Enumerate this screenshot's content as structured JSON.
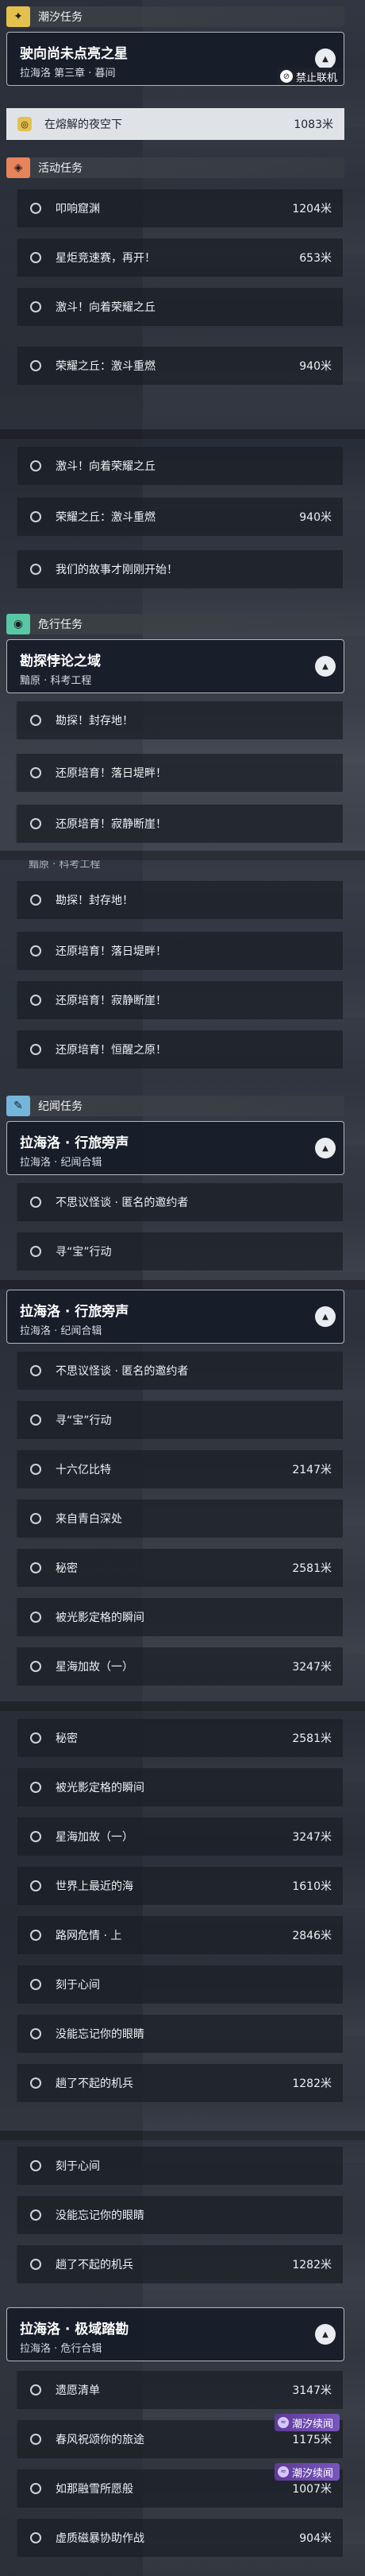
{
  "colors": {
    "tide": "#e4c04d",
    "activity": "#e9835a",
    "danger": "#58c7a4",
    "chronicle": "#74b6da",
    "badge_purple": "#6e4bb3"
  },
  "icons": {
    "tide": "sparkle-icon",
    "activity": "gift-icon",
    "danger": "eye-icon",
    "chronicle": "feather-icon",
    "collapse": "chevron-up-icon",
    "no_coop": "no-coop-icon",
    "tide_badge": "wave-icon"
  },
  "s1": {
    "cat_tide": "潮汐任务",
    "quest_title": "驶向尚未点亮之星",
    "quest_sub": "拉海洛 第三章 · 暮间",
    "no_coop": "禁止联机",
    "active_label": "在熔解的夜空下",
    "active_dist": "1083米",
    "cat_activity": "活动任务",
    "items": [
      {
        "label": "叩响窟渊",
        "dist": "1204米"
      },
      {
        "label": "星炬竞速赛，再开！",
        "dist": "653米"
      },
      {
        "label": "激斗！向着荣耀之丘",
        "dist": ""
      },
      {
        "label": "荣耀之丘：激斗重燃",
        "dist": "940米"
      }
    ]
  },
  "s2": {
    "items": [
      {
        "label": "激斗！向着荣耀之丘",
        "dist": ""
      },
      {
        "label": "荣耀之丘：激斗重燃",
        "dist": "940米"
      },
      {
        "label": "我们的故事才刚刚开始！",
        "dist": ""
      }
    ],
    "cat_danger": "危行任务",
    "quest_title": "勘探悖论之域",
    "quest_sub": "黯原 · 科考工程",
    "items2": [
      {
        "label": "勘探！封存地！",
        "dist": ""
      },
      {
        "label": "还原培育！落日堤畔！",
        "dist": ""
      },
      {
        "label": "还原培育！寂静断崖！",
        "dist": ""
      }
    ]
  },
  "s3": {
    "cut_text": "黯原 · 科考工程",
    "items": [
      {
        "label": "勘探！封存地！",
        "dist": ""
      },
      {
        "label": "还原培育！落日堤畔！",
        "dist": ""
      },
      {
        "label": "还原培育！寂静断崖！",
        "dist": ""
      },
      {
        "label": "还原培育！恒醒之原！",
        "dist": ""
      }
    ],
    "cat_chronicle": "纪闻任务",
    "quest_title": "拉海洛 · 行旅旁声",
    "quest_sub": "拉海洛 · 纪闻合辑",
    "items2": [
      {
        "label": "不思议怪谈 · 匿名的邀约者",
        "dist": ""
      },
      {
        "label": "寻“宝”行动",
        "dist": ""
      }
    ]
  },
  "s4": {
    "quest_title": "拉海洛 · 行旅旁声",
    "quest_sub": "拉海洛 · 纪闻合辑",
    "items": [
      {
        "label": "不思议怪谈 · 匿名的邀约者",
        "dist": ""
      },
      {
        "label": "寻“宝”行动",
        "dist": ""
      },
      {
        "label": "十六亿比特",
        "dist": "2147米"
      },
      {
        "label": "来自青白深处",
        "dist": ""
      },
      {
        "label": "秘密",
        "dist": "2581米"
      },
      {
        "label": "被光影定格的瞬间",
        "dist": ""
      },
      {
        "label": "星海加故（一）",
        "dist": "3247米"
      }
    ]
  },
  "s5": {
    "items": [
      {
        "label": "秘密",
        "dist": "2581米"
      },
      {
        "label": "被光影定格的瞬间",
        "dist": ""
      },
      {
        "label": "星海加故（一）",
        "dist": "3247米"
      },
      {
        "label": "世界上最近的海",
        "dist": "1610米"
      },
      {
        "label": "路网危情 · 上",
        "dist": "2846米"
      },
      {
        "label": "刻于心间",
        "dist": ""
      },
      {
        "label": "没能忘记你的眼睛",
        "dist": ""
      },
      {
        "label": "趟了不起的机兵",
        "dist": "1282米"
      }
    ]
  },
  "s6": {
    "items": [
      {
        "label": "刻于心间",
        "dist": ""
      },
      {
        "label": "没能忘记你的眼睛",
        "dist": ""
      },
      {
        "label": "趟了不起的机兵",
        "dist": "1282米"
      }
    ],
    "quest_title": "拉海洛 · 极域踏勘",
    "quest_sub": "拉海洛 · 危行合辑",
    "items2": [
      {
        "label": "遗愿清单",
        "dist": "3147米",
        "badge": ""
      },
      {
        "label": "春风祝颂你的旅途",
        "dist": "1175米",
        "badge": "潮汐续闻"
      },
      {
        "label": "如那融雪所愿般",
        "dist": "1007米",
        "badge": "潮汐续闻"
      },
      {
        "label": "虚质磁暴协助作战",
        "dist": "904米",
        "badge": ""
      }
    ]
  }
}
